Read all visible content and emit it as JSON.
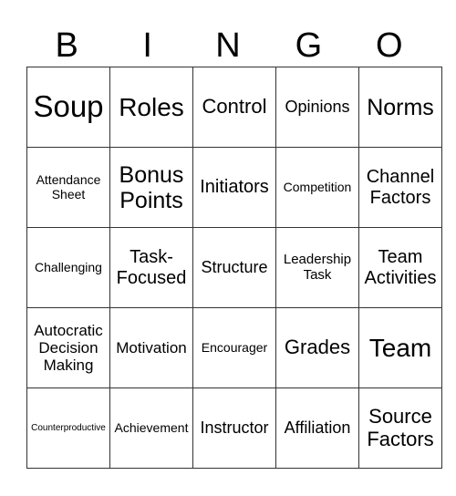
{
  "header": [
    "B",
    "I",
    "N",
    "G",
    "O"
  ],
  "cells": [
    [
      "Soup",
      "Roles",
      "Control",
      "Opinions",
      "Norms"
    ],
    [
      "Attendance Sheet",
      "Bonus Points",
      "Initiators",
      "Competition",
      "Channel Factors"
    ],
    [
      "Challenging",
      "Task-Focused",
      "Structure",
      "Leadership Task",
      "Team Activities"
    ],
    [
      "Autocratic Decision Making",
      "Motivation",
      "Encourager",
      "Grades",
      "Team"
    ],
    [
      "Counterproductive",
      "Achievement",
      "Instructor",
      "Affiliation",
      "Source Factors"
    ]
  ]
}
